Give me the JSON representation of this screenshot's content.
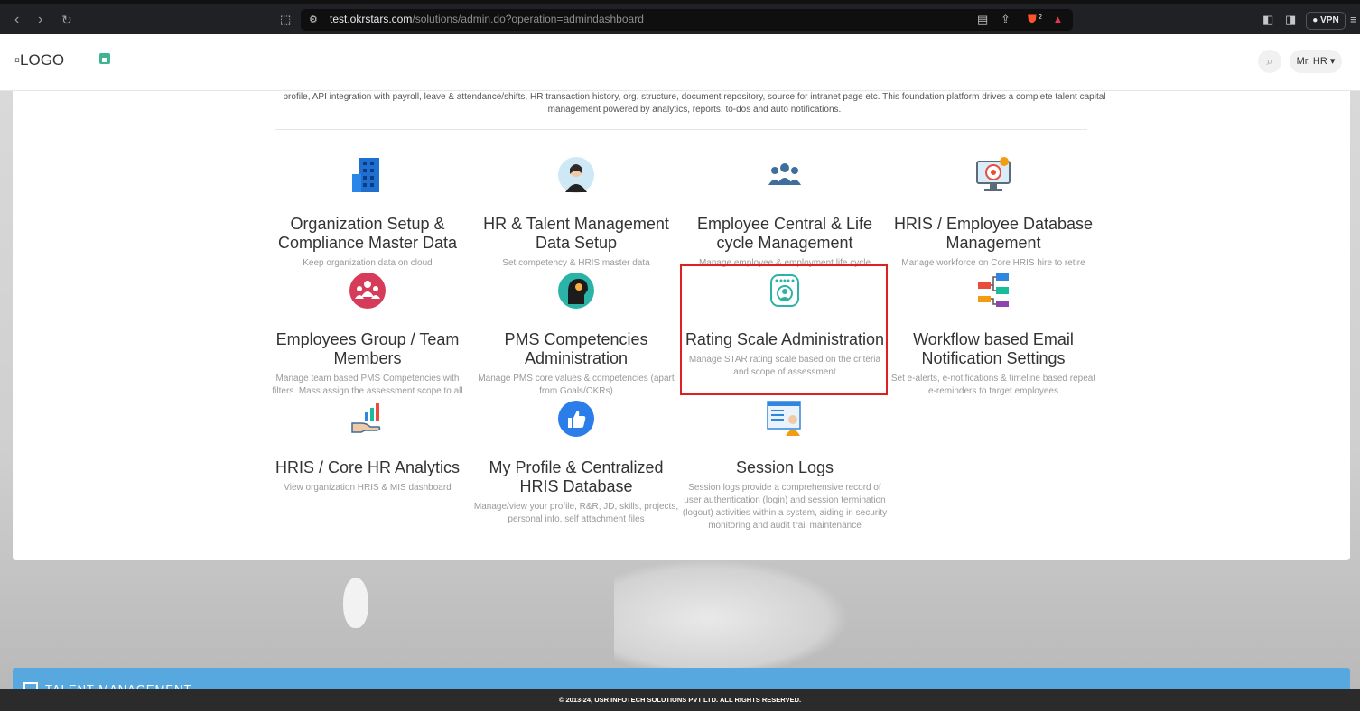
{
  "browser": {
    "url_host": "test.okrstars.com",
    "url_path": "/solutions/admin.do?operation=admindashboard",
    "vpn_label": "VPN",
    "brave_badge": "2"
  },
  "header": {
    "logo_alt": "LOGO",
    "user_label": "Mr. HR ▾"
  },
  "intro_text": "profile, API integration with payroll, leave & attendance/shifts, HR transaction history, org. structure, document repository, source for intranet page etc. This foundation platform drives a complete talent capital management powered by analytics, reports, to-dos and auto notifications.",
  "tiles": [
    {
      "title": "Organization Setup & Compliance Master Data",
      "desc": "Keep organization data on cloud",
      "icon": "building-icon"
    },
    {
      "title": "HR & Talent Management Data Setup",
      "desc": "Set competency & HRIS master data",
      "icon": "hr-person-icon"
    },
    {
      "title": "Employee Central & Life cycle Management",
      "desc": "Manage employee & employment life cycle",
      "icon": "team-icon"
    },
    {
      "title": "HRIS / Employee Database Management",
      "desc": "Manage workforce on Core HRIS hire to retire",
      "icon": "monitor-target-icon"
    },
    {
      "title": "Employees Group / Team Members",
      "desc": "Manage team based PMS Competencies with filters. Mass assign the assessment scope to all",
      "icon": "group-circle-icon"
    },
    {
      "title": "PMS Competencies Administration",
      "desc": "Manage PMS core values & competencies (apart from Goals/OKRs)",
      "icon": "head-gears-icon"
    },
    {
      "title": "Rating Scale Administration",
      "desc": "Manage STAR rating scale based on the criteria and scope of assessment",
      "icon": "rating-badge-icon"
    },
    {
      "title": "Workflow based Email Notification Settings",
      "desc": "Set e-alerts, e-notifications & timeline based repeat e-reminders to target employees",
      "icon": "workflow-icon"
    },
    {
      "title": "HRIS / Core HR Analytics",
      "desc": "View organization HRIS & MIS dashboard",
      "icon": "analytics-hand-icon"
    },
    {
      "title": "My Profile & Centralized HRIS Database",
      "desc": "Manage/view your profile, R&R, JD, skills, projects, personal info, self attachment files",
      "icon": "thumbs-up-icon"
    },
    {
      "title": "Session Logs",
      "desc": "Session logs provide a comprehensive record of user authentication (login) and session termination (logout) activities within a system, aiding in security monitoring and audit trail maintenance",
      "icon": "session-log-icon"
    }
  ],
  "talent_bar": "TALENT MANAGEMENT",
  "footer": "© 2013-24, USR INFOTECH SOLUTIONS PVT LTD. ALL RIGHTS RESERVED.",
  "colors": {
    "highlight": "#e02020",
    "accent_blue": "#56a8df",
    "home_green": "#3fb58f"
  }
}
